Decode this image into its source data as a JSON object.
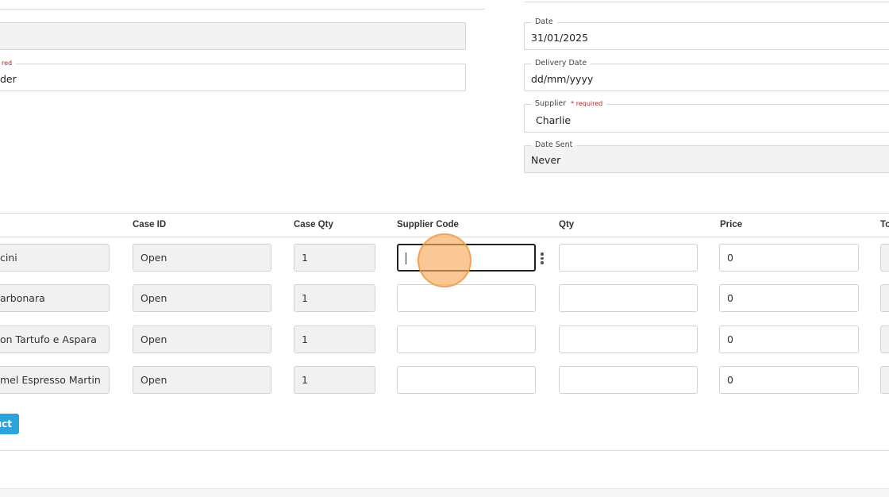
{
  "left_form": {
    "field1_value": "",
    "field2_legend": "red",
    "field2_value": "der"
  },
  "right_form": {
    "date": {
      "label": "Date",
      "value": "31/01/2025"
    },
    "delivery_date": {
      "label": "Delivery Date",
      "value": "dd/mm/yyyy"
    },
    "supplier": {
      "label": "Supplier",
      "required": "* required",
      "value": "Charlie"
    },
    "date_sent": {
      "label": "Date Sent",
      "value": "Never"
    }
  },
  "table": {
    "headers": {
      "case_id": "Case ID",
      "case_qty": "Case Qty",
      "supplier_code": "Supplier Code",
      "qty": "Qty",
      "price": "Price",
      "total": "To"
    },
    "rows": [
      {
        "product": "cini",
        "case_id": "Open",
        "case_qty": "1",
        "supplier_code": "",
        "qty": "",
        "price": "0",
        "total": "("
      },
      {
        "product": "arbonara",
        "case_id": "Open",
        "case_qty": "1",
        "supplier_code": "",
        "qty": "",
        "price": "0",
        "total": "("
      },
      {
        "product": "on Tartufo e Aspara",
        "case_id": "Open",
        "case_qty": "1",
        "supplier_code": "",
        "qty": "",
        "price": "0",
        "total": "("
      },
      {
        "product": "mel Espresso Martin",
        "case_id": "Open",
        "case_qty": "1",
        "supplier_code": "",
        "qty": "",
        "price": "0",
        "total": "("
      }
    ]
  },
  "add_product_button": "uct",
  "icons": {
    "row_menu": "vertical-dots-icon"
  },
  "colors": {
    "accent": "#2ba3db",
    "required": "#b22222",
    "click_indicator": "#f7aa5a"
  }
}
